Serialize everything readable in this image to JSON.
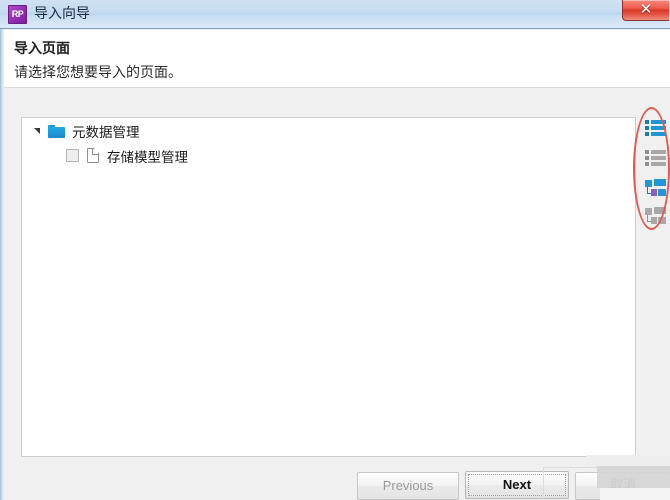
{
  "window": {
    "app_icon_label": "RP",
    "title": "导入向导",
    "close_glyph": "✕"
  },
  "header": {
    "title": "导入页面",
    "subtitle": "请选择您想要导入的页面。"
  },
  "tree": {
    "nodes": [
      {
        "label": "元数据管理",
        "level": 0,
        "type": "folder",
        "expanded": true,
        "has_checkbox": false
      },
      {
        "label": "存储模型管理",
        "level": 1,
        "type": "page",
        "checked": false,
        "has_checkbox": true
      }
    ]
  },
  "side_toolbar": {
    "items": [
      {
        "name": "select-all-icon",
        "state": "active",
        "color": "#2196d6"
      },
      {
        "name": "deselect-all-icon",
        "state": "inactive",
        "color": "#a8a8a8"
      },
      {
        "name": "expand-tree-icon",
        "state": "active",
        "color": "#2196d6"
      },
      {
        "name": "collapse-tree-icon",
        "state": "inactive",
        "color": "#a8a8a8"
      }
    ]
  },
  "annotation": {
    "shape": "ellipse",
    "color": "#e4594f"
  },
  "footer": {
    "previous_label": "Previous",
    "next_label": "Next",
    "cancel_label": "取消"
  },
  "colors": {
    "titlebar_gradient_top": "#cfe0f2",
    "titlebar_gradient_bottom": "#dbeaf8",
    "body_background": "#f0f0f0",
    "header_background": "#ffffff",
    "panel_background": "#ffffff",
    "close_button": "#d93726",
    "accent_blue": "#2196d6",
    "annotation_red": "#e4594f"
  }
}
